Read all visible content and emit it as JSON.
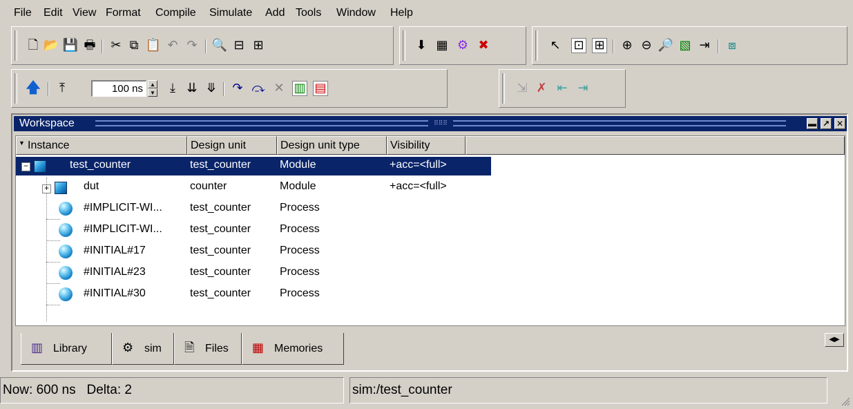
{
  "menu": [
    "File",
    "Edit",
    "View",
    "Format",
    "Compile",
    "Simulate",
    "Add",
    "Tools",
    "Window",
    "Help"
  ],
  "toolbar": {
    "run_length_value": "100 ns",
    "icons_row1": [
      "new-file-icon",
      "open-folder-icon",
      "save-icon",
      "print-icon",
      "cut-icon",
      "copy-icon",
      "paste-icon",
      "undo-icon",
      "redo-icon",
      "find-icon",
      "collapse-icon",
      "expand-icon",
      "compile-icon",
      "compile-all-icon",
      "simulate-icon",
      "break-icon",
      "pointer-icon",
      "zoom-area-icon",
      "zoom-full-icon",
      "zoom-in-icon",
      "zoom-out-icon",
      "zoom-mode-icon",
      "bookmark-icon",
      "goto-icon",
      "dataflow-icon"
    ],
    "icons_row2": [
      "up-arrow-icon",
      "restart-icon",
      "run-icon",
      "continue-icon",
      "run-all-icon",
      "step-icon",
      "step-over-icon",
      "break-run-icon",
      "performance-icon",
      "memory-profile-icon",
      "cursor-icon",
      "delete-cursor-icon",
      "find-previous-edge-icon",
      "find-next-edge-icon"
    ]
  },
  "workspace": {
    "title": "Workspace",
    "columns": [
      "Instance",
      "Design unit",
      "Design unit type",
      "Visibility"
    ],
    "rows": [
      {
        "instance": "test_counter",
        "design_unit": "test_counter",
        "type": "Module",
        "visibility": "+acc=<full>"
      },
      {
        "instance": "dut",
        "design_unit": "counter",
        "type": "Module",
        "visibility": "+acc=<full>"
      },
      {
        "instance": "#IMPLICIT-WI...",
        "design_unit": "test_counter",
        "type": "Process",
        "visibility": ""
      },
      {
        "instance": "#IMPLICIT-WI...",
        "design_unit": "test_counter",
        "type": "Process",
        "visibility": ""
      },
      {
        "instance": "#INITIAL#17",
        "design_unit": "test_counter",
        "type": "Process",
        "visibility": ""
      },
      {
        "instance": "#INITIAL#23",
        "design_unit": "test_counter",
        "type": "Process",
        "visibility": ""
      },
      {
        "instance": "#INITIAL#30",
        "design_unit": "test_counter",
        "type": "Process",
        "visibility": ""
      }
    ],
    "tabs": [
      "Library",
      "sim",
      "Files",
      "Memories"
    ],
    "active_tab": "sim"
  },
  "status": {
    "now": "Now: 600 ns",
    "delta": "Delta: 2",
    "context": "sim:/test_counter"
  },
  "colors": {
    "selection": "#0a246a",
    "face": "#d4d0c8"
  }
}
